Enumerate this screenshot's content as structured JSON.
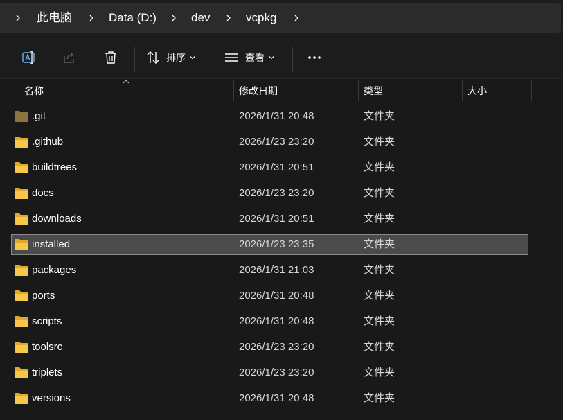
{
  "breadcrumb": {
    "items": [
      {
        "label": "此电脑"
      },
      {
        "label": "Data (D:)"
      },
      {
        "label": "dev"
      },
      {
        "label": "vcpkg"
      }
    ]
  },
  "toolbar": {
    "rename_icon": "rename-icon",
    "share_icon": "share-icon",
    "delete_icon": "trash-icon",
    "sort_label": "排序",
    "view_label": "查看",
    "more_icon": "more-icon"
  },
  "columns": {
    "name": "名称",
    "modified": "修改日期",
    "type": "类型",
    "size": "大小"
  },
  "files": [
    {
      "name": ".git",
      "modified": "2026/1/31 20:48",
      "type": "文件夹",
      "dim": true,
      "selected": false
    },
    {
      "name": ".github",
      "modified": "2026/1/23 23:20",
      "type": "文件夹",
      "dim": false,
      "selected": false
    },
    {
      "name": "buildtrees",
      "modified": "2026/1/31 20:51",
      "type": "文件夹",
      "dim": false,
      "selected": false
    },
    {
      "name": "docs",
      "modified": "2026/1/23 23:20",
      "type": "文件夹",
      "dim": false,
      "selected": false
    },
    {
      "name": "downloads",
      "modified": "2026/1/31 20:51",
      "type": "文件夹",
      "dim": false,
      "selected": false
    },
    {
      "name": "installed",
      "modified": "2026/1/23 23:35",
      "type": "文件夹",
      "dim": false,
      "selected": true
    },
    {
      "name": "packages",
      "modified": "2026/1/31 21:03",
      "type": "文件夹",
      "dim": false,
      "selected": false
    },
    {
      "name": "ports",
      "modified": "2026/1/31 20:48",
      "type": "文件夹",
      "dim": false,
      "selected": false
    },
    {
      "name": "scripts",
      "modified": "2026/1/31 20:48",
      "type": "文件夹",
      "dim": false,
      "selected": false
    },
    {
      "name": "toolsrc",
      "modified": "2026/1/23 23:20",
      "type": "文件夹",
      "dim": false,
      "selected": false
    },
    {
      "name": "triplets",
      "modified": "2026/1/23 23:20",
      "type": "文件夹",
      "dim": false,
      "selected": false
    },
    {
      "name": "versions",
      "modified": "2026/1/31 20:48",
      "type": "文件夹",
      "dim": false,
      "selected": false
    }
  ],
  "colors": {
    "folder": "#f8c649",
    "folder_back": "#e0a92e",
    "folder_dim": "#8a7440",
    "selection": "#4b4b4b",
    "accent_icon": "#6cb2f0"
  }
}
